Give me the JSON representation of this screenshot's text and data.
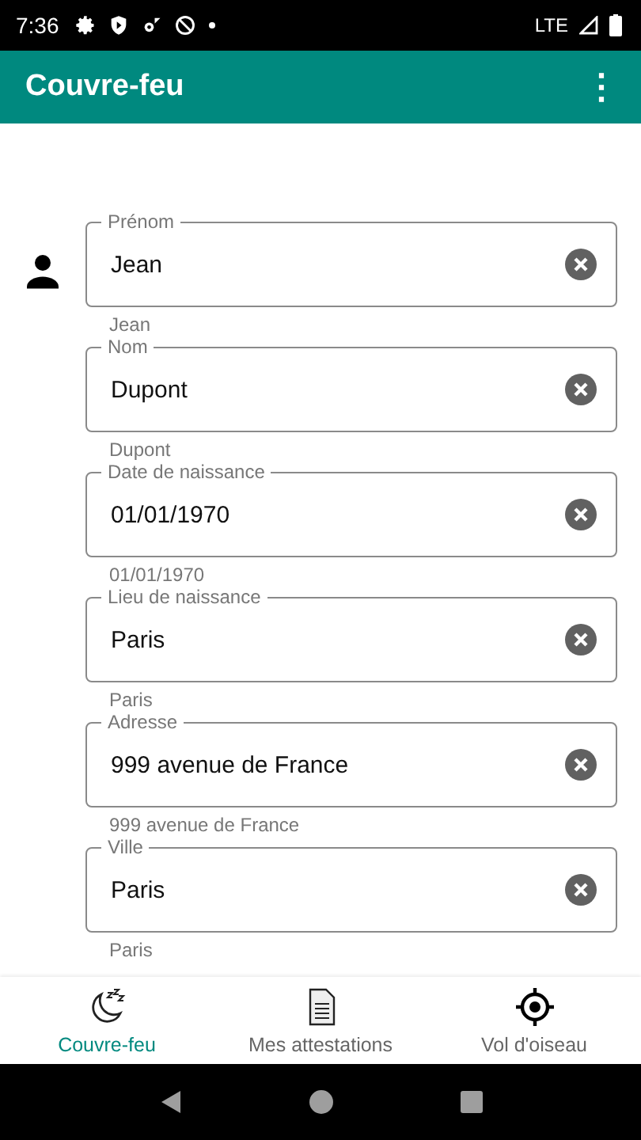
{
  "status_bar": {
    "time": "7:36",
    "network": "LTE"
  },
  "app_bar": {
    "title": "Couvre-feu",
    "menu": "⋮"
  },
  "fields": [
    {
      "label": "Prénom",
      "value": "Jean",
      "helper": "Jean",
      "icon": true
    },
    {
      "label": "Nom",
      "value": "Dupont",
      "helper": "Dupont",
      "icon": false
    },
    {
      "label": "Date de naissance",
      "value": "01/01/1970",
      "helper": "01/01/1970",
      "icon": false
    },
    {
      "label": "Lieu de naissance",
      "value": "Paris",
      "helper": "Paris",
      "icon": false
    },
    {
      "label": "Adresse",
      "value": "999 avenue de France",
      "helper": "999 avenue de France",
      "icon": false
    },
    {
      "label": "Ville",
      "value": "Paris",
      "helper": "Paris",
      "icon": false
    }
  ],
  "bottom_nav": [
    {
      "kind": "moon",
      "label": "Couvre-feu",
      "selected": true
    },
    {
      "kind": "document",
      "label": "Mes attestations",
      "selected": false
    },
    {
      "kind": "target",
      "label": "Vol d'oiseau",
      "selected": false
    }
  ]
}
